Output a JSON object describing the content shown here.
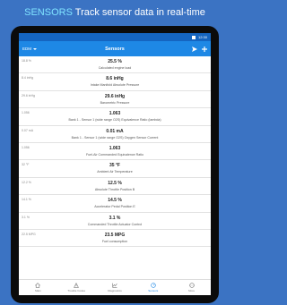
{
  "banner": {
    "brand": "SENSORS",
    "tagline": "Track sensor data in real-time"
  },
  "status_bar": {
    "time": "12:30"
  },
  "appbar": {
    "unit": "EDM",
    "title": "Sensors"
  },
  "sensors": [
    {
      "prev": "18.8 %",
      "value": "25.5 %",
      "name": "Calculated engine load"
    },
    {
      "prev": "8.4 inHg",
      "value": "8.6 inHg",
      "name": "Intake Manifold Absolute Pressure"
    },
    {
      "prev": "29.6 inHg",
      "value": "29.6 inHg",
      "name": "Barometric Pressure"
    },
    {
      "prev": "1.056",
      "value": "1.063",
      "name": "Bank 1 - Sensor 1 (wide range O2S) Equivalence Ratio (lambda)"
    },
    {
      "prev": "0.07 mA",
      "value": "0.01 mA",
      "name": "Bank 1 - Sensor 1 (wide range O2S) Oxygen Sensor Current"
    },
    {
      "prev": "1.056",
      "value": "1.063",
      "name": "Fuel-Air Commanded Equivalence Ratio"
    },
    {
      "prev": "32 °F",
      "value": "35 °F",
      "name": "Ambient Air Temperature"
    },
    {
      "prev": "12.2 %",
      "value": "12.5 %",
      "name": "Absolute Throttle Position B"
    },
    {
      "prev": "14.1 %",
      "value": "14.5 %",
      "name": "Accelerator Pedal Position E"
    },
    {
      "prev": "3.1 %",
      "value": "3.1 %",
      "name": "Commanded Throttle Actuator Control"
    },
    {
      "prev": "22.5 MPG",
      "value": "23.5 MPG",
      "name": "Fuel consumption"
    }
  ],
  "bottom_nav": [
    {
      "label": "Main",
      "icon": "home-icon"
    },
    {
      "label": "Trouble Codes",
      "icon": "warning-icon"
    },
    {
      "label": "Diagnostics",
      "icon": "chart-icon"
    },
    {
      "label": "Sensors",
      "icon": "gauge-icon",
      "active": true
    },
    {
      "label": "More",
      "icon": "more-icon"
    }
  ],
  "colors": {
    "background": "#3b73c3",
    "appbar": "#1e88e5",
    "statusbar": "#1565c0",
    "brand_text": "#7fe3ff"
  }
}
